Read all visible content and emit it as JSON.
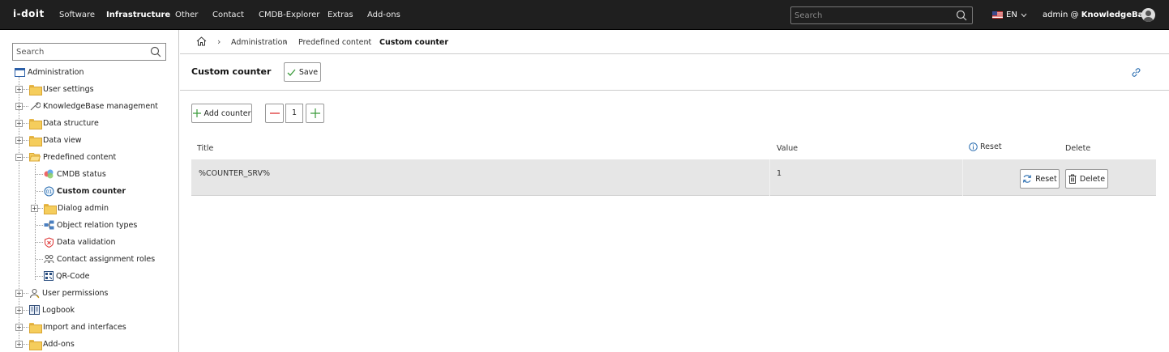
{
  "topbar": {
    "logo": "i-doit",
    "nav": [
      "Software",
      "Infrastructure",
      "Other",
      "Contact",
      "CMDB-Explorer",
      "Extras",
      "Add-ons"
    ],
    "active_nav": "Infrastructure",
    "search_placeholder": "Search",
    "language": "EN",
    "user_prefix": "admin @ ",
    "user_tenant": "KnowledgeBase"
  },
  "sidebar": {
    "search_placeholder": "Search",
    "root": "Administration",
    "items": [
      {
        "label": "User settings",
        "icon": "folder-icon"
      },
      {
        "label": "KnowledgeBase management",
        "icon": "wrench-icon"
      },
      {
        "label": "Data structure",
        "icon": "folder-icon"
      },
      {
        "label": "Data view",
        "icon": "folder-icon"
      },
      {
        "label": "Predefined content",
        "icon": "folder-open-icon"
      },
      {
        "label": "CMDB status",
        "icon": "status-icon"
      },
      {
        "label": "Custom counter",
        "icon": "counter-icon"
      },
      {
        "label": "Dialog admin",
        "icon": "folder-icon"
      },
      {
        "label": "Object relation types",
        "icon": "relation-icon"
      },
      {
        "label": "Data validation",
        "icon": "validation-icon"
      },
      {
        "label": "Contact assignment roles",
        "icon": "roles-icon"
      },
      {
        "label": "QR-Code",
        "icon": "qr-code-icon"
      },
      {
        "label": "User permissions",
        "icon": "permissions-icon"
      },
      {
        "label": "Logbook",
        "icon": "logbook-icon"
      },
      {
        "label": "Import and interfaces",
        "icon": "folder-icon"
      },
      {
        "label": "Add-ons",
        "icon": "folder-icon"
      }
    ]
  },
  "breadcrumb": [
    "Administration",
    "Predefined content",
    "Custom counter"
  ],
  "page": {
    "title": "Custom counter",
    "save_label": "Save",
    "add_counter_label": "Add counter",
    "counter_quantity": "1"
  },
  "table": {
    "headers": {
      "title": "Title",
      "value": "Value",
      "reset": "Reset",
      "delete": "Delete"
    },
    "rows": [
      {
        "title": "%COUNTER_SRV%",
        "value": "1",
        "reset_label": "Reset",
        "delete_label": "Delete"
      }
    ]
  },
  "colors": {
    "topbar": "#1f1f1f",
    "row": "#e6e6e6",
    "accent_green": "#3a9a3a",
    "accent_blue": "#2a6db0"
  }
}
